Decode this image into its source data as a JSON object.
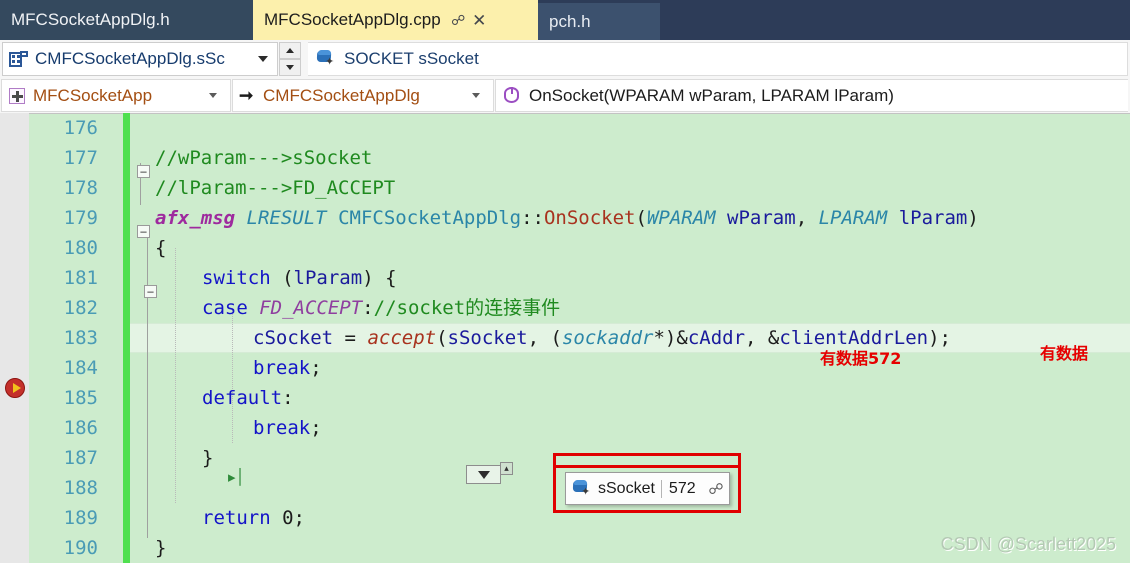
{
  "window": {
    "theme_bg": "#2d3c58",
    "editor_bg": "#cdeccd",
    "accent_active_tab": "#fcf0ac",
    "change_marker_color": "#4fe04f"
  },
  "tabstrip": {
    "tabs": [
      {
        "label": "MFCSocketAppDlg.h",
        "active": false
      },
      {
        "label": "MFCSocketAppDlg.cpp",
        "active": true,
        "pin_icon": "pin-icon",
        "close_icon": "close-icon"
      },
      {
        "label": "pch.h",
        "active": false
      }
    ]
  },
  "watch_row": {
    "icon": "member-variable-icon",
    "value": "CMFCSocketAppDlg.sSc",
    "dropdown_icon": "chevron-down-icon",
    "spinner_up_icon": "spinner-up-icon",
    "spinner_down_icon": "spinner-down-icon",
    "declaration_icon": "variable-icon",
    "declaration": "SOCKET sSocket"
  },
  "navbar": {
    "project": {
      "icon": "project-icon",
      "label": "MFCSocketApp",
      "dropdown_icon": "chevron-down-icon"
    },
    "class": {
      "icon": "arrow-right-icon",
      "label": "CMFCSocketAppDlg",
      "dropdown_icon": "chevron-down-icon"
    },
    "method": {
      "icon": "method-icon",
      "label": "OnSocket(WPARAM wParam, LPARAM lParam)"
    }
  },
  "editor": {
    "breakpoint_glyph": "breakpoint-current-statement-icon",
    "breakpoint_line": 181,
    "lines": [
      {
        "num": "176",
        "text": ""
      },
      {
        "num": "177",
        "text": "//wParam--->sSocket"
      },
      {
        "num": "178",
        "text": "//lParam--->FD_ACCEPT"
      },
      {
        "num": "179",
        "text": "afx_msg LRESULT CMFCSocketAppDlg::OnSocket(WPARAM wParam, LPARAM lParam)"
      },
      {
        "num": "180",
        "text": "{"
      },
      {
        "num": "181",
        "text": "    switch (lParam) {"
      },
      {
        "num": "182",
        "text": "    case FD_ACCEPT://socket的连接事件"
      },
      {
        "num": "183",
        "text": "        cSocket = accept(sSocket, (sockaddr*)&cAddr, &clientAddrLen);"
      },
      {
        "num": "184",
        "text": "        break;"
      },
      {
        "num": "185",
        "text": "    default:"
      },
      {
        "num": "186",
        "text": "        break;"
      },
      {
        "num": "187",
        "text": "    }"
      },
      {
        "num": "188",
        "text": ""
      },
      {
        "num": "189",
        "text": "    return 0;"
      },
      {
        "num": "190",
        "text": "}"
      }
    ],
    "annotations": [
      {
        "text": "有数据572",
        "color": "#e60000"
      },
      {
        "text": "有数据",
        "color": "#e60000"
      }
    ],
    "quick_actions_icon": "quick-actions-dropdown-icon",
    "step_marker_icon": "step-into-specific-icon"
  },
  "datatip": {
    "icon": "variable-icon",
    "name": "sSocket",
    "value": "572",
    "pin_icon": "pin-to-source-icon",
    "highlight_color": "#e00000"
  },
  "watermark": "CSDN @Scarlett2025"
}
